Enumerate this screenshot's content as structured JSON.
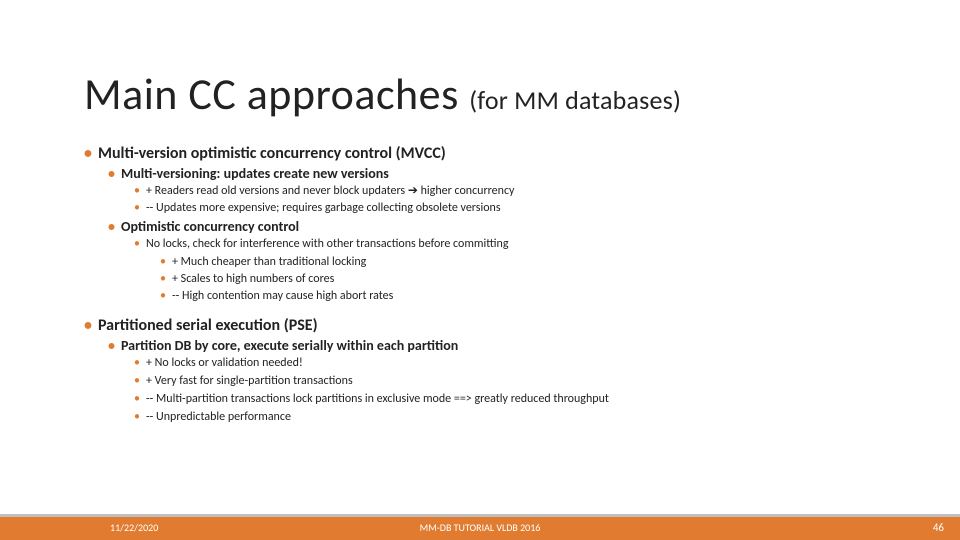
{
  "title": {
    "main": "Main CC approaches ",
    "sub": "(for MM databases)"
  },
  "content": {
    "mvcc": {
      "heading": "Multi-version optimistic concurrency control (MVCC)",
      "mv": {
        "heading": "Multi-versioning: updates create new versions",
        "points": [
          "+ Readers read old versions and never block updaters  ➔  higher concurrency",
          "-- Updates more expensive; requires garbage collecting obsolete versions"
        ]
      },
      "occ": {
        "heading": "Optimistic concurrency control",
        "lead": "No locks, check for interference with other transactions before committing",
        "points": [
          "+ Much cheaper than traditional locking",
          "+ Scales to high numbers of cores",
          "-- High contention may cause high abort rates"
        ]
      }
    },
    "pse": {
      "heading": "Partitioned serial execution (PSE)",
      "sub": "Partition DB by core, execute serially within each partition",
      "points": [
        "+ No locks or validation needed!",
        "+ Very fast for single-partition transactions",
        "-- Multi-partition transactions lock partitions in exclusive mode ==> greatly reduced throughput",
        "-- Unpredictable performance"
      ]
    }
  },
  "footer": {
    "date": "11/22/2020",
    "center": "MM-DB TUTORIAL VLDB 2016",
    "page": "46"
  }
}
